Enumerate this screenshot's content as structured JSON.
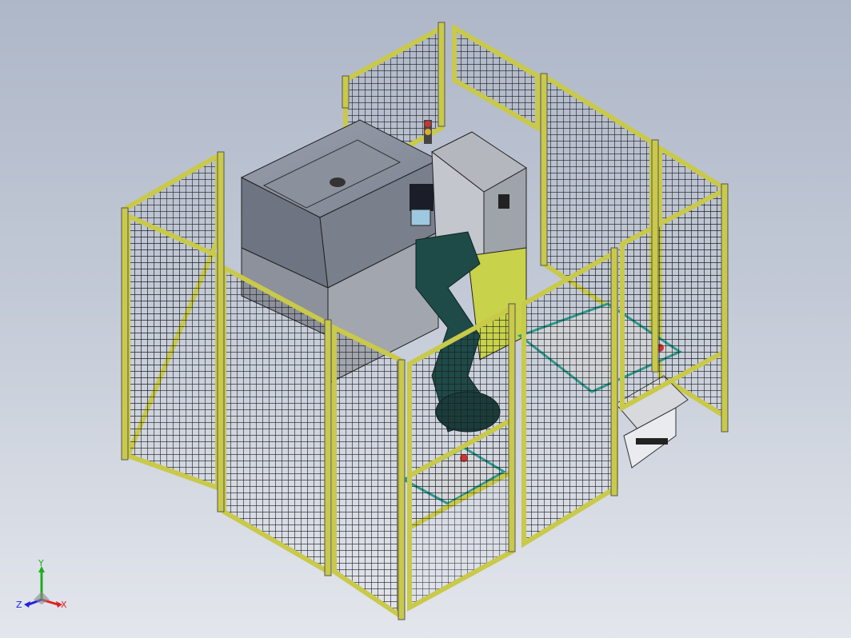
{
  "colors": {
    "fence_frame": "#c9c94a",
    "fence_mesh": "#1a1a1a",
    "machine_body": "#7f8493",
    "cabinet": "#a9acb3",
    "cabinet_base": "#c8d24a",
    "robot": "#1e4a48",
    "conveyor_accent": "#2a9a8e",
    "axis_x": "#d22",
    "axis_y": "#2a2",
    "axis_z": "#22d"
  },
  "triad": {
    "x_label": "X",
    "y_label": "Y",
    "z_label": "Z"
  }
}
